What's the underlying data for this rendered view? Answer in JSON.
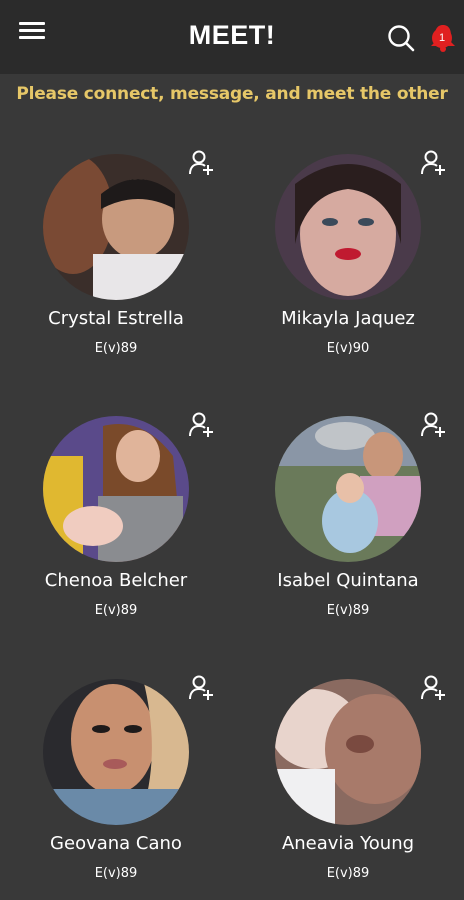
{
  "header": {
    "title": "MEET!",
    "notification_count": "1",
    "menu_icon": "hamburger-menu-icon",
    "search_icon": "search-icon",
    "bell_icon": "bell-icon"
  },
  "banner": {
    "text": "Please connect, message, and meet the other"
  },
  "colors": {
    "background": "#393939",
    "header": "#2b2b2b",
    "banner_text": "#e6c768",
    "badge": "#e02020"
  },
  "profiles": [
    {
      "name": "Crystal Estrella",
      "ev": "E(v)89"
    },
    {
      "name": "Mikayla Jaquez",
      "ev": "E(v)90"
    },
    {
      "name": "Chenoa Belcher",
      "ev": "E(v)89"
    },
    {
      "name": "Isabel Quintana",
      "ev": "E(v)89"
    },
    {
      "name": "Geovana Cano",
      "ev": "E(v)89"
    },
    {
      "name": "Aneavia Young",
      "ev": "E(v)89"
    }
  ]
}
